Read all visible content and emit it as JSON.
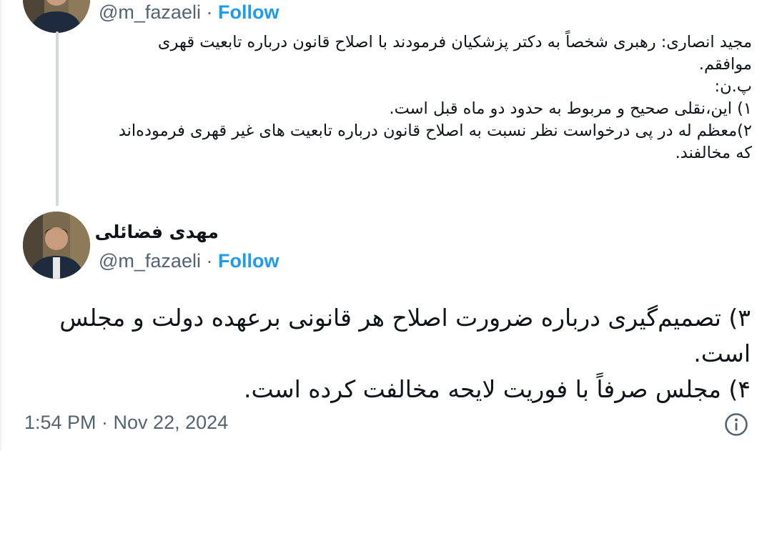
{
  "quoted_tweet": {
    "handle": "@m_fazaeli",
    "separator": "·",
    "follow_label": "Follow",
    "lines": [
      "مجید انصاری: رهبری شخصاً به دکتر پزشکیان فرمودند با اصلاح قانون درباره تابعیت قهری موافقم.",
      "پ.ن:",
      "۱) این،نقلی صحیح و مربوط به حدود دو ماه قبل است.",
      "۲)معظم له در پی درخواست نظر نسبت به اصلاح قانون درباره تابعیت های غیر قهری فرموده‌اند که مخالفند."
    ]
  },
  "main_tweet": {
    "display_name": "مهدی فضائلی",
    "handle": "@m_fazaeli",
    "separator": "·",
    "follow_label": "Follow",
    "lines": [
      "۳) تصمیم‌گیری درباره ضرورت اصلاح هر قانونی برعهده دولت و مجلس است.",
      "۴) مجلس صرفاً با فوریت لایحه مخالفت کرده است."
    ],
    "timestamp": "1:54 PM · Nov 22, 2024",
    "info_icon": "info-circle-icon"
  },
  "colors": {
    "text": "#0f1419",
    "secondary": "#536471",
    "follow": "#1d9bf0",
    "thread_line": "#cfd9de"
  }
}
